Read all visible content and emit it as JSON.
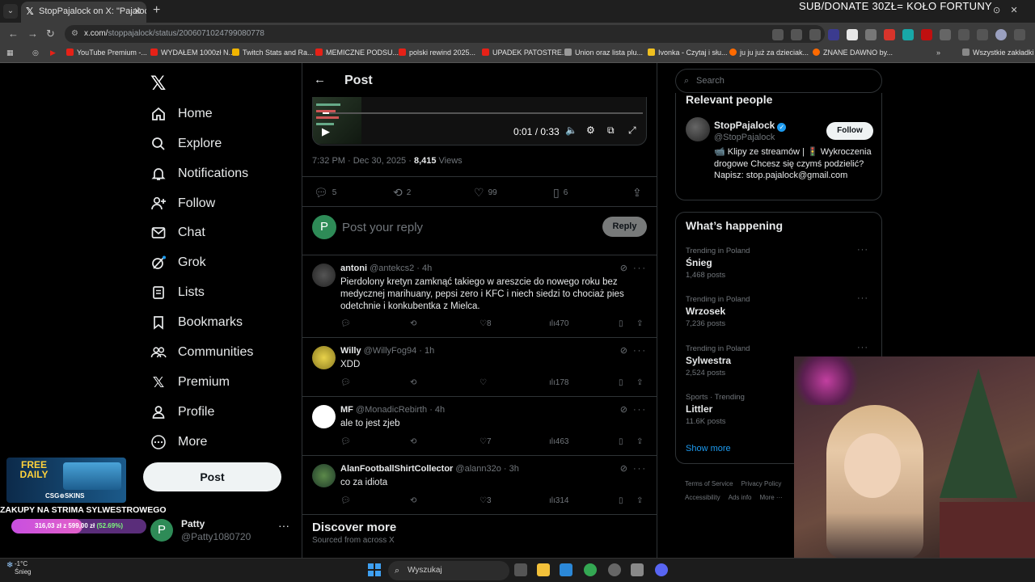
{
  "browser": {
    "tab_title": "StopPajalock on X: \"Pajalock po",
    "url_host": "x.com/",
    "url_path": "stoppajalock/status/2006071024799080778",
    "bookmarks": [
      {
        "label": "YouTube Premium -...",
        "color": "#e62117"
      },
      {
        "label": "WYDAŁEM 1000zł N...",
        "color": "#e62117"
      },
      {
        "label": "Twitch Stats and Ra...",
        "color": "#f0b400"
      },
      {
        "label": "MEMICZNE PODSU...",
        "color": "#e62117"
      },
      {
        "label": "polski rewind 2025...",
        "color": "#e62117"
      },
      {
        "label": "UPADEK PATOSTRE...",
        "color": "#e62117"
      },
      {
        "label": "Union oraz lista plu...",
        "color": "#999999"
      },
      {
        "label": "Ivonka - Czytaj i słu...",
        "color": "#f0c020"
      },
      {
        "label": "ju ju już za dzieciak...",
        "color": "#ff6a00"
      },
      {
        "label": "ZNANE DAWNO by...",
        "color": "#ff6a00"
      }
    ],
    "all_bookmarks": "Wszystkie zakładki"
  },
  "stream": {
    "banner": "SUB/DONATE 30ZŁ= KOŁO FORTUNY",
    "promo_free": "FREE DAILY",
    "promo_brand": "CSG⊕SKINS",
    "goal_title": "ZAKUPY NA STRIMA SYLWESTROWEGO",
    "goal_current": "316,03 zł z 599,00 zł",
    "goal_percent": "(52.69%)",
    "goal_fraction": 0.5269
  },
  "nav": {
    "items": [
      {
        "label": "Home",
        "icon": "home-icon"
      },
      {
        "label": "Explore",
        "icon": "search-icon"
      },
      {
        "label": "Notifications",
        "icon": "bell-icon"
      },
      {
        "label": "Follow",
        "icon": "person-plus-icon"
      },
      {
        "label": "Chat",
        "icon": "mail-icon"
      },
      {
        "label": "Grok",
        "icon": "grok-icon"
      },
      {
        "label": "Lists",
        "icon": "list-icon"
      },
      {
        "label": "Bookmarks",
        "icon": "bookmark-icon"
      },
      {
        "label": "Communities",
        "icon": "people-icon"
      },
      {
        "label": "Premium",
        "icon": "x-icon"
      },
      {
        "label": "Profile",
        "icon": "profile-icon"
      },
      {
        "label": "More",
        "icon": "more-circle-icon"
      }
    ],
    "post_label": "Post"
  },
  "account": {
    "avatar_letter": "P",
    "name": "Patty",
    "handle": "@Patty1080720"
  },
  "post": {
    "header_title": "Post",
    "video_time": "0:01 / 0:33",
    "timestamp": "7:32 PM · Dec 30, 2025 · ",
    "views_count": "8,415",
    "views_label": " Views",
    "replies": "5",
    "reposts": "2",
    "likes": "99",
    "bookmarks": "6",
    "reply_placeholder": "Post your reply",
    "reply_button": "Reply",
    "reply_avatar_letter": "P"
  },
  "replies": [
    {
      "name": "antoni",
      "handle": "@antekcs2 · 4h",
      "text": "Pierdolony kretyn zamknąć takiego w areszcie do nowego roku bez medycznej marihuany, pepsi zero i KFC i niech siedzi to chociaż pies odetchnie i konkubentka z Mielca.",
      "likes": "8",
      "views": "470"
    },
    {
      "name": "Willy",
      "handle": "@WillyFog94 · 1h",
      "text": "XDD",
      "likes": "",
      "views": "178"
    },
    {
      "name": "MF",
      "handle": "@MonadicRebirth · 4h",
      "text": "ale to jest zjeb",
      "likes": "7",
      "views": "463"
    },
    {
      "name": "AlanFootballShirtCollector",
      "handle": "@alann32o · 3h",
      "text": "co za idiota",
      "likes": "3",
      "views": "314"
    }
  ],
  "discover": {
    "title": "Discover more",
    "subtitle": "Sourced from across X"
  },
  "sidebar": {
    "search_placeholder": "Search",
    "relevant_title": "Relevant people",
    "person_name": "StopPajalock",
    "person_handle": "@StopPajalock",
    "follow_label": "Follow",
    "bio": "📹 Klipy ze streamów | 🚦 Wykroczenia drogowe Chcesz się czymś podzielić? Napisz: stop.pajalock@gmail.com",
    "happening_title": "What’s happening",
    "trends": [
      {
        "context": "Trending in Poland",
        "name": "Śnieg",
        "count": "1,468 posts"
      },
      {
        "context": "Trending in Poland",
        "name": "Wrzosek",
        "count": "7,236 posts"
      },
      {
        "context": "Trending in Poland",
        "name": "Sylwestra",
        "count": "2,524 posts"
      },
      {
        "context": "Sports · Trending",
        "name": "Littler",
        "count": "11.6K posts"
      }
    ],
    "show_more": "Show more",
    "footer": [
      "Terms of Service",
      "Privacy Policy",
      "Accessibility",
      "Ads info",
      "More ···"
    ]
  },
  "taskbar": {
    "temp": "-1°C",
    "weather": "Śnieg",
    "search": "Wyszukaj"
  }
}
